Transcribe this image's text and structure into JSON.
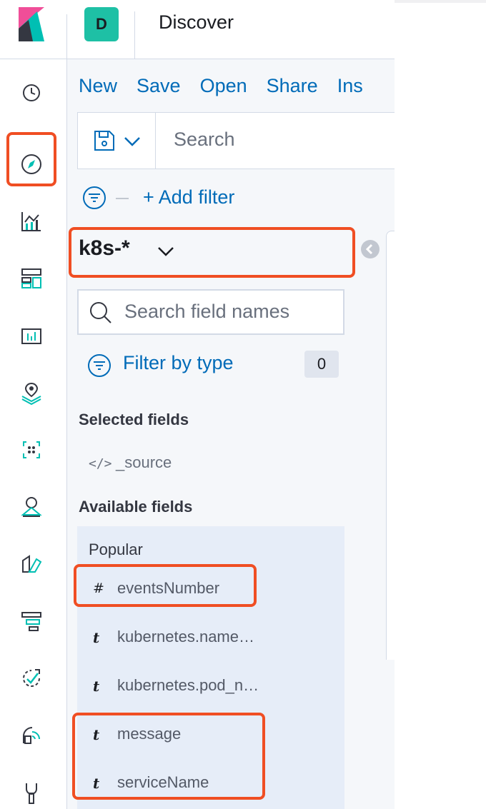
{
  "header": {
    "space_initial": "D",
    "page_title": "Discover"
  },
  "nav_icons": [
    "clock-icon",
    "compass-icon",
    "visualize-icon",
    "dashboard-icon",
    "canvas-icon",
    "maps-icon",
    "ml-icon",
    "infrastructure-icon",
    "logs-icon",
    "apm-icon",
    "uptime-icon",
    "siem-icon",
    "dev-tools-icon"
  ],
  "topnav": {
    "items": [
      "New",
      "Save",
      "Open",
      "Share",
      "Ins"
    ]
  },
  "query": {
    "placeholder": "Search"
  },
  "filter": {
    "add_label": "+ Add filter"
  },
  "index_pattern": {
    "name": "k8s-*"
  },
  "sidebar": {
    "field_search_placeholder": "Search field names",
    "filter_by_type_label": "Filter by type",
    "filter_count": "0",
    "selected_fields_title": "Selected fields",
    "selected_fields": [
      {
        "type": "</>",
        "name": "_source"
      }
    ],
    "available_fields_title": "Available fields",
    "popular_title": "Popular",
    "popular_fields": [
      {
        "type": "#",
        "name": "eventsNumber"
      },
      {
        "type": "t",
        "name": "kubernetes.name…"
      },
      {
        "type": "t",
        "name": "kubernetes.pod_n…"
      },
      {
        "type": "t",
        "name": "message"
      },
      {
        "type": "t",
        "name": "serviceName"
      }
    ]
  },
  "colors": {
    "accent": "#006bb8",
    "highlight": "#f04e23",
    "space_badge": "#1ec0a5",
    "popular_bg": "#e6edf8"
  }
}
